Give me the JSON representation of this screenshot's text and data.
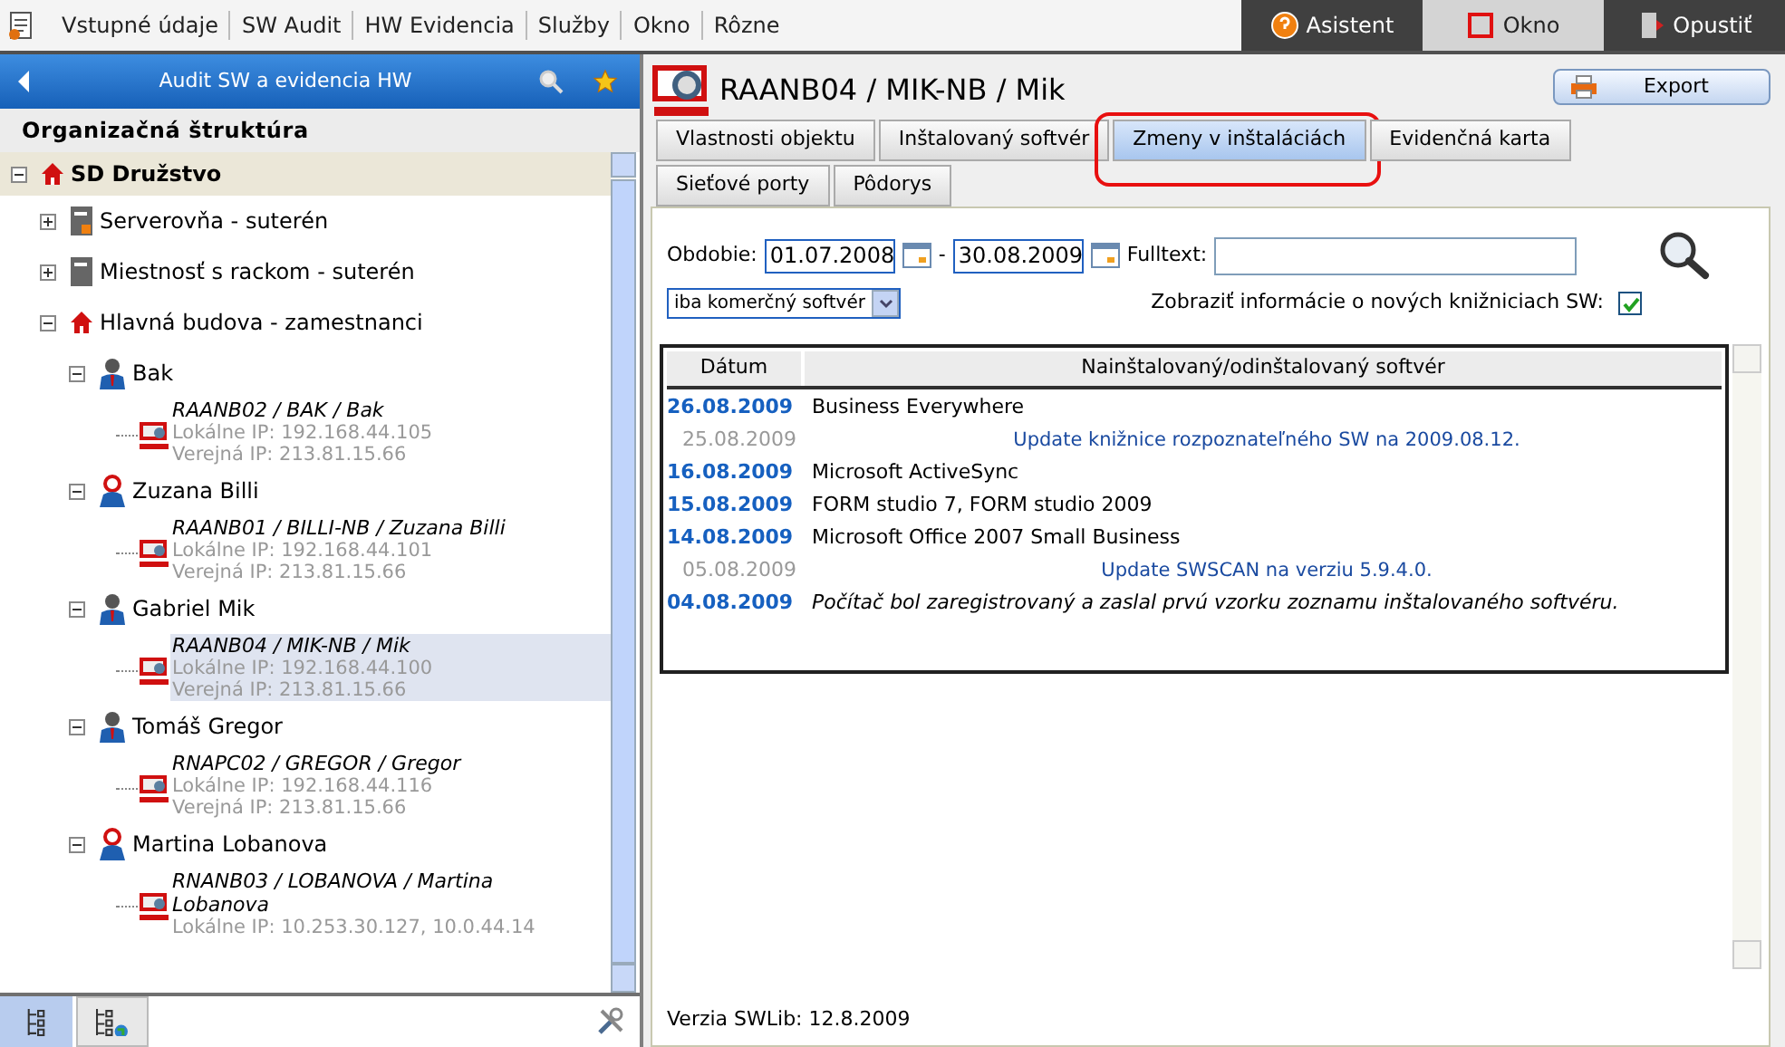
{
  "menu": {
    "items": [
      {
        "label": "Vstupné údaje"
      },
      {
        "label": "SW Audit"
      },
      {
        "label": "HW Evidencia"
      },
      {
        "label": "Služby"
      },
      {
        "label": "Okno"
      },
      {
        "label": "Rôzne"
      }
    ],
    "right": [
      {
        "label": "Asistent",
        "kind": "assistant",
        "selected": false
      },
      {
        "label": "Okno",
        "kind": "window",
        "selected": true
      },
      {
        "label": "Opustiť",
        "kind": "exit",
        "selected": false
      }
    ]
  },
  "sidebar": {
    "title": "Audit SW a evidencia HW",
    "tree_title": "Organizačná štruktúra",
    "tree": [
      {
        "label": "SD Družstvo",
        "kind": "org",
        "expanded": true,
        "selected": false,
        "children": [
          {
            "label": "Serverovňa - suterén",
            "kind": "server-room",
            "expanded": false,
            "selected": false
          },
          {
            "label": "Miestnosť s rackom - suterén",
            "kind": "room",
            "expanded": false,
            "selected": false
          },
          {
            "label": "Hlavná budova - zamestnanci",
            "kind": "building",
            "expanded": true,
            "selected": false,
            "children": [
              {
                "label": "Bak",
                "kind": "man",
                "expanded": true,
                "selected": false,
                "children": [
                  {
                    "label": "RAANB02 / BAK  / Bak",
                    "kind": "computer",
                    "local_ip": "Lokálne IP: 192.168.44.105",
                    "public_ip": "Verejná IP: 213.81.15.66",
                    "selected": false
                  }
                ]
              },
              {
                "label": "Zuzana Billi",
                "kind": "woman",
                "expanded": true,
                "selected": false,
                "children": [
                  {
                    "label": "RAANB01 / BILLI-NB / Zuzana Billi",
                    "kind": "computer",
                    "local_ip": "Lokálne IP: 192.168.44.101",
                    "public_ip": "Verejná IP: 213.81.15.66",
                    "selected": false
                  }
                ]
              },
              {
                "label": "Gabriel Mik",
                "kind": "man",
                "expanded": true,
                "selected": false,
                "children": [
                  {
                    "label": "RAANB04 / MIK-NB / Mik",
                    "kind": "computer",
                    "local_ip": "Lokálne IP: 192.168.44.100",
                    "public_ip": "Verejná IP: 213.81.15.66",
                    "selected": true
                  }
                ]
              },
              {
                "label": "Tomáš Gregor",
                "kind": "man",
                "expanded": true,
                "selected": false,
                "children": [
                  {
                    "label": "RNAPC02 / GREGOR / Gregor",
                    "kind": "computer",
                    "local_ip": "Lokálne IP: 192.168.44.116",
                    "public_ip": "Verejná IP: 213.81.15.66",
                    "selected": false
                  }
                ]
              },
              {
                "label": "Martina Lobanova",
                "kind": "woman",
                "expanded": true,
                "selected": false,
                "children": [
                  {
                    "label": "RNANB03 / LOBANOVA / Martina Lobanova",
                    "kind": "computer",
                    "local_ip": "Lokálne IP: 10.253.30.127, 10.0.44.14",
                    "selected": false
                  }
                ]
              }
            ]
          }
        ]
      }
    ],
    "view_tabs": [
      {
        "kind": "tree",
        "selected": true
      },
      {
        "kind": "tree-globe",
        "selected": false
      }
    ]
  },
  "detail": {
    "title": "RAANB04 / MIK-NB / Mik",
    "export_label": "Export",
    "tabs": [
      {
        "label": "Vlastnosti objektu",
        "selected": false,
        "highlighted": false
      },
      {
        "label": "Inštalovaný softvér",
        "selected": false,
        "highlighted": false
      },
      {
        "label": "Zmeny v inštaláciách",
        "selected": true,
        "highlighted": true
      },
      {
        "label": "Evidenčná karta",
        "selected": false,
        "highlighted": false
      },
      {
        "label": "Sieťové porty",
        "selected": false,
        "highlighted": false
      },
      {
        "label": "Pôdorys",
        "selected": false,
        "highlighted": false
      }
    ],
    "period_label": "Obdobie:",
    "date_from": "01.07.2008",
    "date_separator": "-",
    "date_to": "30.08.2009",
    "fulltext_label": "Fulltext:",
    "filter": "iba komerčný softvér",
    "show_libs_label": "Zobraziť informácie o nových knižniciach SW:",
    "show_libs": true,
    "table": {
      "columns": [
        "Dátum",
        "Nainštalovaný/odinštalovaný softvér"
      ],
      "rows": [
        {
          "kind": "change",
          "date": "26.08.2009",
          "text": "Business Everywhere"
        },
        {
          "kind": "update",
          "date": "25.08.2009",
          "text": "Update knižnice rozpoznateľného SW na 2009.08.12."
        },
        {
          "kind": "change",
          "date": "16.08.2009",
          "text": "Microsoft ActiveSync"
        },
        {
          "kind": "change",
          "date": "15.08.2009",
          "text": "FORM studio 7, FORM studio 2009"
        },
        {
          "kind": "change",
          "date": "14.08.2009",
          "text": "Microsoft Office 2007 Small Business"
        },
        {
          "kind": "update",
          "date": "05.08.2009",
          "text": "Update SWSCAN na verziu 5.9.4.0."
        },
        {
          "kind": "registration",
          "date": "04.08.2009",
          "text": "Počítač bol zaregistrovaný a zaslal prvú vzorku zoznamu inštalovaného softvéru."
        }
      ]
    },
    "footer": "Verzia SWLib: 12.8.2009"
  }
}
